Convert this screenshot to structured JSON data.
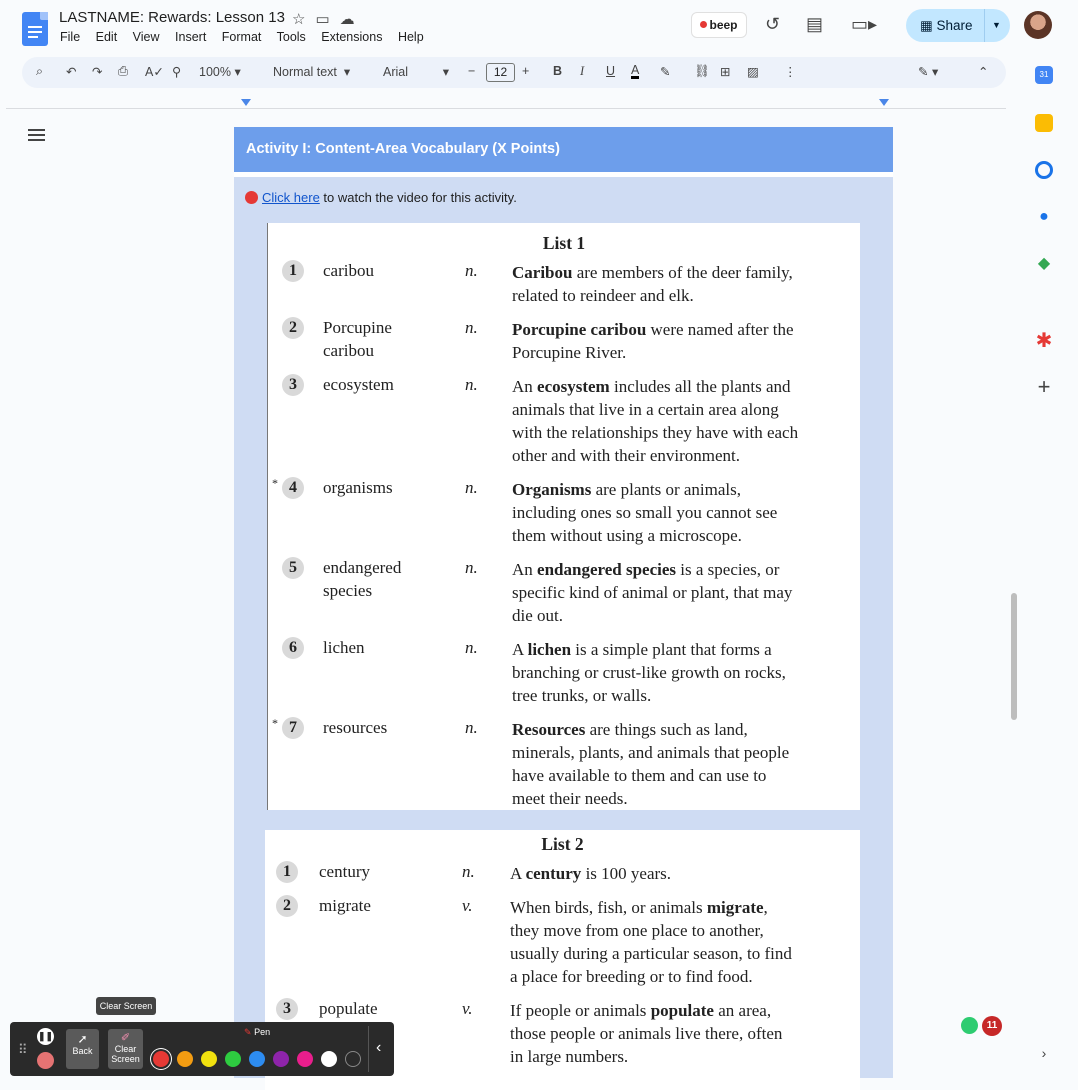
{
  "header": {
    "title": "LASTNAME: Rewards: Lesson 13",
    "menu": [
      "File",
      "Edit",
      "View",
      "Insert",
      "Format",
      "Tools",
      "Extensions",
      "Help"
    ],
    "beep_label": "beep",
    "share_label": "Share"
  },
  "toolbar": {
    "zoom": "100%",
    "style": "Normal text",
    "font": "Arial",
    "font_size": "12"
  },
  "activity": {
    "heading": "Activity I: Content-Area Vocabulary (X Points)",
    "link_text": "Click here",
    "link_suffix": " to watch the video for this activity."
  },
  "list1": {
    "title": "List 1",
    "items": [
      {
        "num": "1",
        "star": "",
        "word": [
          "caribou"
        ],
        "pos": "n.",
        "lines": [
          [
            {
              "b": "Caribou"
            },
            " are members of the deer family,"
          ],
          [
            "related to reindeer and elk."
          ]
        ]
      },
      {
        "num": "2",
        "star": "",
        "word": [
          "Porcupine",
          "caribou"
        ],
        "pos": "n.",
        "lines": [
          [
            {
              "b": "Porcupine caribou"
            },
            " were named after the"
          ],
          [
            "Porcupine River."
          ]
        ]
      },
      {
        "num": "3",
        "star": "",
        "word": [
          "ecosystem"
        ],
        "pos": "n.",
        "lines": [
          [
            "An ",
            {
              "b": "ecosystem"
            },
            " includes all the plants and"
          ],
          [
            "animals that live in a certain area along"
          ],
          [
            "with the relationships they have with each"
          ],
          [
            "other and with their environment."
          ]
        ]
      },
      {
        "num": "4",
        "star": "*",
        "word": [
          "organisms"
        ],
        "pos": "n.",
        "lines": [
          [
            {
              "b": "Organisms"
            },
            " are plants or animals,"
          ],
          [
            "including ones so small you cannot see"
          ],
          [
            "them without using a microscope."
          ]
        ]
      },
      {
        "num": "5",
        "star": "",
        "word": [
          "endangered",
          "species"
        ],
        "pos": "n.",
        "lines": [
          [
            "An ",
            {
              "b": "endangered species"
            },
            " is a species, or"
          ],
          [
            "specific kind of animal or plant, that may"
          ],
          [
            "die out."
          ]
        ]
      },
      {
        "num": "6",
        "star": "",
        "word": [
          "lichen"
        ],
        "pos": "n.",
        "lines": [
          [
            "A ",
            {
              "b": "lichen"
            },
            " is a simple plant that forms a"
          ],
          [
            "branching or crust-like growth on rocks,"
          ],
          [
            "tree trunks, or walls."
          ]
        ]
      },
      {
        "num": "7",
        "star": "*",
        "word": [
          "resources"
        ],
        "pos": "n.",
        "lines": [
          [
            {
              "b": "Resources"
            },
            " are things such as land,"
          ],
          [
            "minerals, plants, and animals that people"
          ],
          [
            "have available to them and can use to"
          ],
          [
            "meet their needs."
          ]
        ]
      }
    ]
  },
  "list2": {
    "title": "List 2",
    "items": [
      {
        "num": "1",
        "star": "",
        "word": [
          "century"
        ],
        "pos": "n.",
        "lines": [
          [
            "A ",
            {
              "b": "century"
            },
            " is 100 years."
          ]
        ]
      },
      {
        "num": "2",
        "star": "",
        "word": [
          "migrate"
        ],
        "pos": "v.",
        "lines": [
          [
            "When birds, fish, or animals ",
            {
              "b": "migrate"
            },
            ","
          ],
          [
            "they move from one place to another,"
          ],
          [
            "usually during a particular season, to find"
          ],
          [
            "a place for breeding or to find food."
          ]
        ]
      },
      {
        "num": "3",
        "star": "",
        "word": [
          "populate"
        ],
        "pos": "v.",
        "lines": [
          [
            "If people or animals ",
            {
              "b": "populate"
            },
            " an area,"
          ],
          [
            "those people or animals live there, often"
          ],
          [
            "in large numbers."
          ]
        ]
      }
    ]
  },
  "annotate": {
    "tooltip": "Clear Screen",
    "back_label": "Back",
    "clear_label": "Clear Screen",
    "pen_label": "Pen",
    "colors": [
      "#e53935",
      "#f39c12",
      "#f1e10f",
      "#2ecc40",
      "#2d8cf0",
      "#8e24aa",
      "#e91e8c",
      "#ffffff",
      "#2a2a2a"
    ]
  },
  "notifications": {
    "count": "11"
  }
}
